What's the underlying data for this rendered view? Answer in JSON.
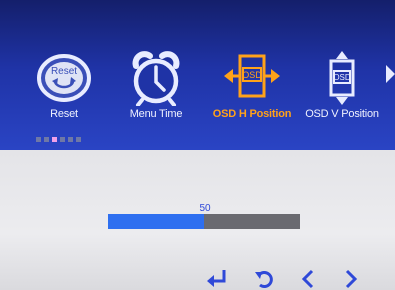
{
  "menu": {
    "items": [
      {
        "label": "Reset",
        "icon": "reset-icon",
        "selected": false
      },
      {
        "label": "Menu Time",
        "icon": "alarm-clock-icon",
        "selected": false
      },
      {
        "label": "OSD H Position",
        "icon": "osd-horizontal-position-icon",
        "selected": true
      },
      {
        "label": "OSD V Position",
        "icon": "osd-vertical-position-icon",
        "selected": false
      }
    ],
    "reset_icon_text": "Reset",
    "osd_icon_text": "OSD",
    "more_indicator": "right-arrow-icon"
  },
  "pager": {
    "total": 6,
    "active_index": 2
  },
  "slider": {
    "value": "50",
    "fraction": 0.5
  },
  "nav_buttons": [
    {
      "icon": "enter-icon"
    },
    {
      "icon": "back-icon"
    },
    {
      "icon": "chevron-left-icon"
    },
    {
      "icon": "chevron-right-icon"
    }
  ],
  "colors": {
    "menu_background": "#1f33a6",
    "selected_label": "#ffa21a",
    "label": "#f0f2ff",
    "slider_fill": "#2e6ff0",
    "slider_track": "#6a6a70",
    "nav_icon": "#2f49d8",
    "content_background": "#ececef"
  }
}
